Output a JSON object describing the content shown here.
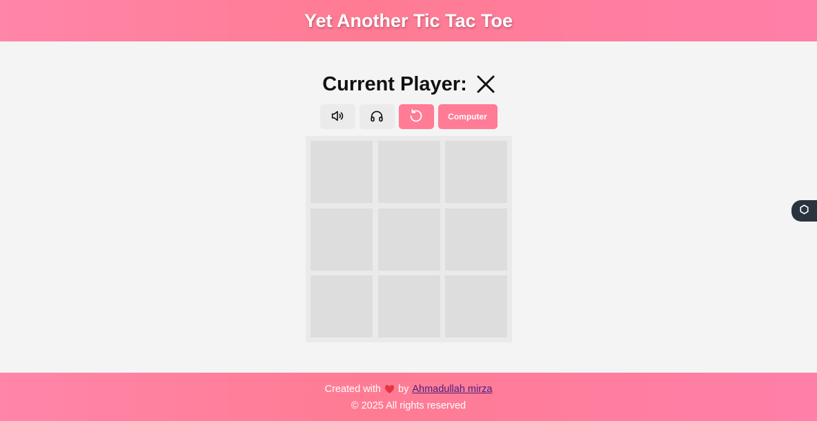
{
  "header": {
    "title": "Yet Another Tic Tac Toe"
  },
  "status": {
    "label": "Current Player:",
    "current_player": "X"
  },
  "controls": {
    "sound_icon": "speaker-icon",
    "music_icon": "headphones-icon",
    "reset_icon": "restart-icon",
    "mode_label": "Computer"
  },
  "board": {
    "cells": [
      "",
      "",
      "",
      "",
      "",
      "",
      "",
      "",
      ""
    ]
  },
  "footer": {
    "created_prefix": "Created with",
    "heart_icon": "heart-icon",
    "by_text": "by",
    "author": "Ahmadullah mirza",
    "copyright": "© 2025 All rights reserved"
  },
  "side_widget": {
    "icon": "hexagon-icon"
  },
  "colors": {
    "accent": "#ff7b96",
    "background": "#f4f4f4",
    "cell": "#dddddd",
    "widget": "#2b3340",
    "link": "#4a2080"
  }
}
